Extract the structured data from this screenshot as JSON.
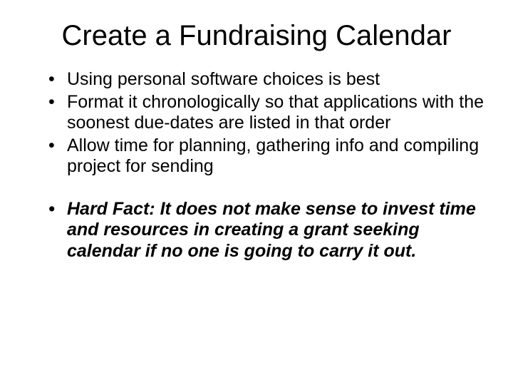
{
  "title": "Create a Fundraising Calendar",
  "bullets": {
    "b1": "Using personal software choices is best",
    "b2": "Format it chronologically so that applications with the soonest due-dates are listed in that order",
    "b3": "Allow time for planning, gathering info and compiling project for sending",
    "b4": "Hard Fact: It does not make sense to invest time and resources in creating a grant seeking calendar if no one is going to carry it out."
  }
}
